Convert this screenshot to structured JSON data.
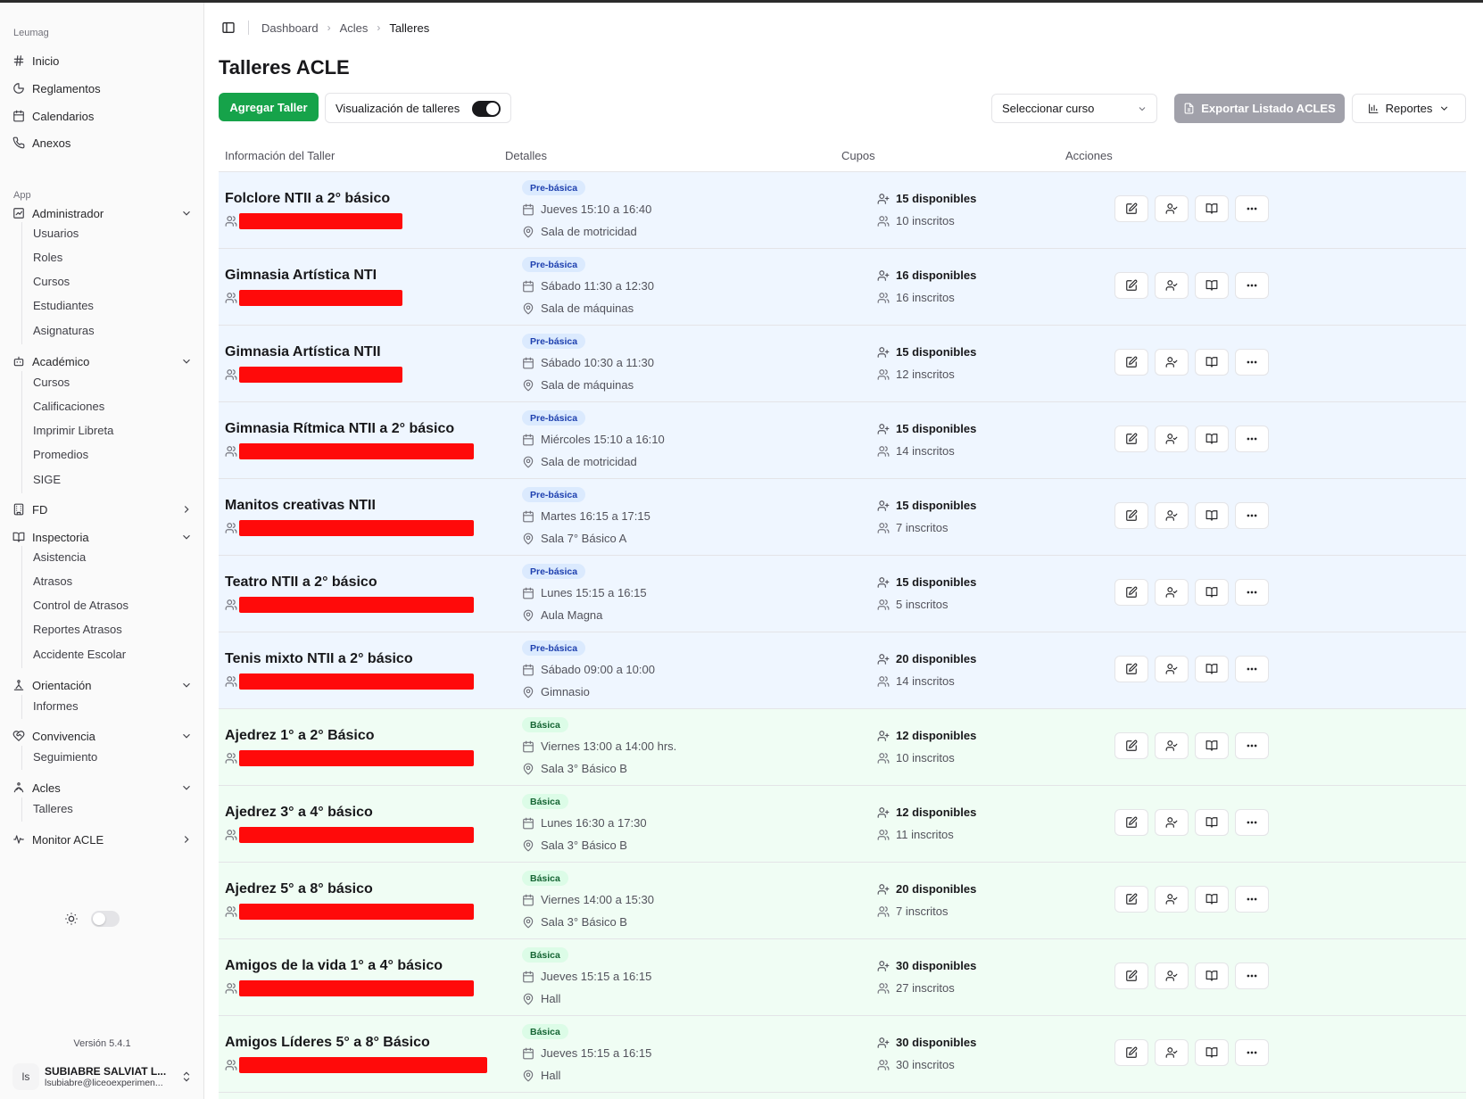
{
  "app": {
    "org_label": "Leumag",
    "app_group_label": "App",
    "version": "Versión 5.4.1"
  },
  "sidebar": {
    "top_items": [
      {
        "label": "Inicio",
        "icon": "hash-icon"
      },
      {
        "label": "Reglamentos",
        "icon": "pie-chart-icon"
      },
      {
        "label": "Calendarios",
        "icon": "calendar-icon"
      },
      {
        "label": "Anexos",
        "icon": "phone-icon"
      }
    ],
    "groups": [
      {
        "label": "Administrador",
        "icon": "admin-icon",
        "expanded": true,
        "children": [
          "Usuarios",
          "Roles",
          "Cursos",
          "Estudiantes",
          "Asignaturas"
        ]
      },
      {
        "label": "Académico",
        "icon": "bot-icon",
        "expanded": true,
        "children": [
          "Cursos",
          "Calificaciones",
          "Imprimir Libreta",
          "Promedios",
          "SIGE"
        ]
      },
      {
        "label": "FD",
        "icon": "building-icon",
        "expanded": false,
        "children": []
      },
      {
        "label": "Inspectoria",
        "icon": "book-icon",
        "expanded": true,
        "children": [
          "Asistencia",
          "Atrasos",
          "Control de Atrasos",
          "Reportes Atrasos",
          "Accidente Escolar"
        ]
      },
      {
        "label": "Orientación",
        "icon": "orientation-icon",
        "expanded": true,
        "children": [
          "Informes"
        ]
      },
      {
        "label": "Convivencia",
        "icon": "heart-handshake-icon",
        "expanded": true,
        "children": [
          "Seguimiento"
        ]
      },
      {
        "label": "Acles",
        "icon": "acles-icon",
        "expanded": true,
        "children": [
          "Talleres"
        ]
      },
      {
        "label": "Monitor ACLE",
        "icon": "activity-icon",
        "expanded": false,
        "children": []
      }
    ]
  },
  "user": {
    "initials": "ls",
    "name": "SUBIABRE SALVIAT L...",
    "email": "lsubiabre@liceoexperimen..."
  },
  "breadcrumb": [
    "Dashboard",
    "Acles",
    "Talleres"
  ],
  "page": {
    "title": "Talleres ACLE",
    "add_button": "Agregar Taller",
    "view_toggle_label": "Visualización de talleres",
    "view_toggle_on": true,
    "course_select_placeholder": "Seleccionar curso",
    "export_button": "Exportar Listado ACLES",
    "reports_button": "Reportes"
  },
  "table": {
    "headers": [
      "Información del Taller",
      "Detalles",
      "Cupos",
      "Acciones"
    ],
    "rows": [
      {
        "title": "Folclore NTII a 2° básico",
        "level": "Pre-básica",
        "kind": "pre",
        "schedule": "Jueves 15:10 a 16:40",
        "room": "Sala de motricidad",
        "available": "15 disponibles",
        "enrolled": "10 inscritos"
      },
      {
        "title": "Gimnasia Artística NTI",
        "level": "Pre-básica",
        "kind": "pre",
        "schedule": "Sábado 11:30 a 12:30",
        "room": "Sala de máquinas",
        "available": "16 disponibles",
        "enrolled": "16 inscritos"
      },
      {
        "title": "Gimnasia Artística NTII",
        "level": "Pre-básica",
        "kind": "pre",
        "schedule": "Sábado 10:30 a 11:30",
        "room": "Sala de máquinas",
        "available": "15 disponibles",
        "enrolled": "12 inscritos"
      },
      {
        "title": "Gimnasia Rítmica NTII a 2° básico",
        "level": "Pre-básica",
        "kind": "pre",
        "schedule": "Miércoles 15:10 a 16:10",
        "room": "Sala de motricidad",
        "available": "15 disponibles",
        "enrolled": "14 inscritos"
      },
      {
        "title": "Manitos creativas NTII",
        "level": "Pre-básica",
        "kind": "pre",
        "schedule": "Martes 16:15 a 17:15",
        "room": "Sala 7° Básico A",
        "available": "15 disponibles",
        "enrolled": "7 inscritos"
      },
      {
        "title": "Teatro NTII a 2° básico",
        "level": "Pre-básica",
        "kind": "pre",
        "schedule": "Lunes 15:15 a 16:15",
        "room": "Aula Magna",
        "available": "15 disponibles",
        "enrolled": "5 inscritos"
      },
      {
        "title": "Tenis mixto NTII a 2° básico",
        "level": "Pre-básica",
        "kind": "pre",
        "schedule": "Sábado 09:00 a 10:00",
        "room": "Gimnasio",
        "available": "20 disponibles",
        "enrolled": "14 inscritos"
      },
      {
        "title": "Ajedrez 1° a 2° Básico",
        "level": "Básica",
        "kind": "bas",
        "schedule": "Viernes 13:00 a 14:00 hrs.",
        "room": "Sala 3° Básico B",
        "available": "12 disponibles",
        "enrolled": "10 inscritos"
      },
      {
        "title": "Ajedrez 3° a 4° básico",
        "level": "Básica",
        "kind": "bas",
        "schedule": "Lunes 16:30 a 17:30",
        "room": "Sala 3° Básico B",
        "available": "12 disponibles",
        "enrolled": "11 inscritos"
      },
      {
        "title": "Ajedrez 5° a 8° básico",
        "level": "Básica",
        "kind": "bas",
        "schedule": "Viernes 14:00 a 15:30",
        "room": "Sala 3° Básico B",
        "available": "20 disponibles",
        "enrolled": "7 inscritos"
      },
      {
        "title": "Amigos de la vida 1° a 4° básico",
        "level": "Básica",
        "kind": "bas",
        "schedule": "Jueves 15:15 a 16:15",
        "room": "Hall",
        "available": "30 disponibles",
        "enrolled": "27 inscritos"
      },
      {
        "title": "Amigos Líderes 5° a 8° Básico",
        "level": "Básica",
        "kind": "bas",
        "schedule": "Jueves 15:15 a 16:15",
        "room": "Hall",
        "available": "30 disponibles",
        "enrolled": "30 inscritos"
      }
    ],
    "action_icons": [
      "edit-icon",
      "user-check-icon",
      "book-open-icon",
      "more-horizontal-icon"
    ]
  },
  "colors": {
    "primary_green": "#16a34a",
    "prebasica_row": "#eff6ff",
    "basica_row": "#f0fdf4",
    "redaction": "#ff0a0a"
  }
}
